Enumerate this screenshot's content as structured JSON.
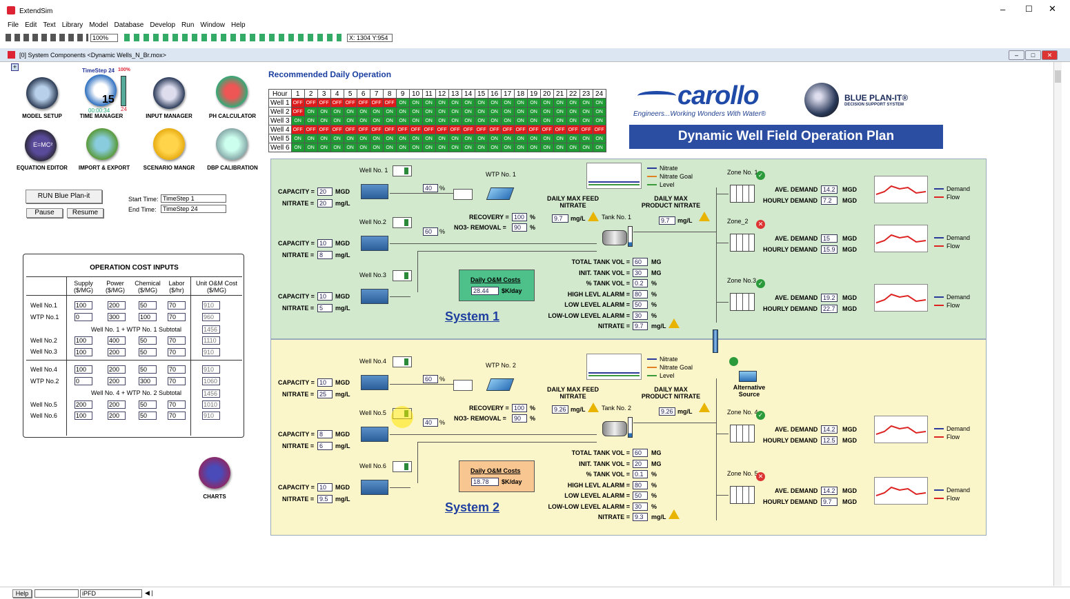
{
  "app": {
    "title": "ExtendSim"
  },
  "menu": [
    "File",
    "Edit",
    "Text",
    "Library",
    "Model",
    "Database",
    "Develop",
    "Run",
    "Window",
    "Help"
  ],
  "toolbar": {
    "zoom": "100%",
    "coords": "X: 1304  Y:954"
  },
  "doc": {
    "title": "[0]  System Components   <Dynamic Wells_N_Br.mox>"
  },
  "header": {
    "timestep": "TimeStep 24",
    "percent": "100%",
    "clock": "00:00:34",
    "day": "15",
    "step": "24"
  },
  "icons": [
    {
      "label": "MODEL SETUP"
    },
    {
      "label": "TIME MANAGER"
    },
    {
      "label": "INPUT MANAGER"
    },
    {
      "label": "PH CALCULATOR"
    },
    {
      "label": "EQUATION EDITOR"
    },
    {
      "label": "IMPORT & EXPORT"
    },
    {
      "label": "SCENARIO MANGR"
    },
    {
      "label": "DBP CALIBRATION"
    }
  ],
  "controls": {
    "run": "RUN Blue Plan-it",
    "pause": "Pause",
    "resume": "Resume",
    "start_label": "Start Time:",
    "start": "TimeStep 1",
    "end_label": "End Time:",
    "end": "TimeStep 24"
  },
  "cost": {
    "title": "OPERATION COST INPUTS",
    "headers": [
      "Supply\n($/MG)",
      "Power\n($/MG)",
      "Chemical\n($/MG)",
      "Labor\n($/hr)",
      "Unit O&M Cost\n($/MG)"
    ],
    "rows": [
      {
        "name": "Well No.1",
        "v": [
          "100",
          "200",
          "50",
          "70",
          "910"
        ]
      },
      {
        "name": "WTP No.1",
        "v": [
          "0",
          "300",
          "100",
          "70",
          "960"
        ]
      },
      {
        "sub": "Well No. 1 + WTP No. 1 Subtotal",
        "total": "1456"
      },
      {
        "name": "Well No.2",
        "v": [
          "100",
          "400",
          "50",
          "70",
          "1110"
        ]
      },
      {
        "name": "Well No.3",
        "v": [
          "100",
          "200",
          "50",
          "70",
          "910"
        ]
      },
      {
        "name": "Well No.4",
        "v": [
          "100",
          "200",
          "50",
          "70",
          "910"
        ]
      },
      {
        "name": "WTP No.2",
        "v": [
          "0",
          "200",
          "300",
          "70",
          "1060"
        ]
      },
      {
        "sub": "Well No. 4 + WTP No. 2 Subtotal",
        "total": "1456"
      },
      {
        "name": "Well No.5",
        "v": [
          "200",
          "200",
          "50",
          "70",
          "1010"
        ]
      },
      {
        "name": "Well No.6",
        "v": [
          "100",
          "200",
          "50",
          "70",
          "910"
        ]
      }
    ]
  },
  "charts_label": "CHARTS",
  "rdo": {
    "title": "Recommended Daily Operation",
    "hour": "Hour",
    "wells": [
      {
        "name": "Well 1",
        "states": [
          "OFF",
          "OFF",
          "OFF",
          "OFF",
          "OFF",
          "OFF",
          "OFF",
          "OFF",
          "ON",
          "ON",
          "ON",
          "ON",
          "ON",
          "ON",
          "ON",
          "ON",
          "ON",
          "ON",
          "ON",
          "ON",
          "ON",
          "ON",
          "ON",
          "ON"
        ]
      },
      {
        "name": "Well 2",
        "states": [
          "OFF",
          "ON",
          "ON",
          "ON",
          "ON",
          "ON",
          "ON",
          "ON",
          "ON",
          "ON",
          "ON",
          "ON",
          "ON",
          "ON",
          "ON",
          "ON",
          "ON",
          "ON",
          "ON",
          "ON",
          "ON",
          "ON",
          "ON",
          "ON"
        ]
      },
      {
        "name": "Well 3",
        "states": [
          "ON",
          "ON",
          "ON",
          "ON",
          "ON",
          "ON",
          "ON",
          "ON",
          "ON",
          "ON",
          "ON",
          "ON",
          "ON",
          "ON",
          "ON",
          "ON",
          "ON",
          "ON",
          "ON",
          "ON",
          "ON",
          "ON",
          "ON",
          "ON"
        ]
      },
      {
        "name": "Well 4",
        "states": [
          "OFF",
          "OFF",
          "OFF",
          "OFF",
          "OFF",
          "OFF",
          "OFF",
          "OFF",
          "OFF",
          "OFF",
          "OFF",
          "OFF",
          "OFF",
          "OFF",
          "OFF",
          "OFF",
          "OFF",
          "OFF",
          "OFF",
          "OFF",
          "OFF",
          "OFF",
          "OFF",
          "OFF"
        ]
      },
      {
        "name": "Well 5",
        "states": [
          "ON",
          "ON",
          "ON",
          "ON",
          "ON",
          "ON",
          "ON",
          "ON",
          "ON",
          "ON",
          "ON",
          "ON",
          "ON",
          "ON",
          "ON",
          "ON",
          "ON",
          "ON",
          "ON",
          "ON",
          "ON",
          "ON",
          "ON",
          "ON"
        ]
      },
      {
        "name": "Well 6",
        "states": [
          "ON",
          "ON",
          "ON",
          "ON",
          "ON",
          "ON",
          "ON",
          "ON",
          "ON",
          "ON",
          "ON",
          "ON",
          "ON",
          "ON",
          "ON",
          "ON",
          "ON",
          "ON",
          "ON",
          "ON",
          "ON",
          "ON",
          "ON",
          "ON"
        ]
      }
    ]
  },
  "brand": {
    "carollo": "carollo",
    "tagline": "Engineers...Working Wonders With Water®",
    "bp": "BLUE PLAN-IT®",
    "bp_sub": "DECISION SUPPORT SYSTEM",
    "banner": "Dynamic Well Field Operation Plan"
  },
  "s1": {
    "title": "System 1",
    "w1": {
      "label": "Well No. 1",
      "cap": "20",
      "nit": "20"
    },
    "w2": {
      "label": "Well No.2",
      "cap": "10",
      "nit": "8"
    },
    "w3": {
      "label": "Well No.3",
      "cap": "10",
      "nit": "5"
    },
    "wtp": "WTP No. 1",
    "p1": "40",
    "p2": "60",
    "rec": "100",
    "no3": "90",
    "feed": "9.7",
    "prod": "9.7",
    "tank": "Tank No. 1",
    "om": "Daily O&M Costs",
    "omv": "28.44",
    "ttv": "60",
    "init": "30",
    "pct": "0.2",
    "hi": "80",
    "lo": "50",
    "lolo": "30",
    "nit": "9.7",
    "z1": {
      "label": "Zone No. 1",
      "d": "14.2",
      "h": "7.2"
    },
    "z2": {
      "label": "Zone_2",
      "d": "15",
      "h": "15.9"
    },
    "z3": {
      "label": "Zone No.3",
      "d": "19.2",
      "h": "22.7"
    }
  },
  "s2": {
    "title": "System 2",
    "w4": {
      "label": "Well No.4",
      "cap": "10",
      "nit": "25"
    },
    "w5": {
      "label": "Well No.5",
      "cap": "8",
      "nit": "6"
    },
    "w6": {
      "label": "Well No.6",
      "cap": "10",
      "nit": "9.5"
    },
    "wtp": "WTP No. 2",
    "p1": "60",
    "p2": "40",
    "rec": "100",
    "no3": "90",
    "feed": "9.26",
    "prod": "9.26",
    "tank": "Tank No. 2",
    "om": "Daily O&M Costs",
    "omv": "18.78",
    "ttv": "60",
    "init": "20",
    "pct": "0.1",
    "hi": "80",
    "lo": "50",
    "lolo": "30",
    "nit": "9.3",
    "z4": {
      "label": "Zone No. 4",
      "d": "14.2",
      "h": "12.5"
    },
    "z5": {
      "label": "Zone No. 5",
      "d": "14.2",
      "h": "9.7"
    },
    "alt": "Alternative Source"
  },
  "labels": {
    "capacity": "CAPACITY =",
    "nitrate": "NITRATE =",
    "mgd": "MGD",
    "mgl": "mg/L",
    "pctsign": "%",
    "recovery": "RECOVERY =",
    "no3": "NO3- REMOVAL =",
    "feed": "DAILY MAX FEED NITRATE",
    "prod": "DAILY MAX PRODUCT NITRATE",
    "kday": "$K/day",
    "ttv": "TOTAL TANK VOL =",
    "init": "INIT. TANK VOL =",
    "pct": "% TANK VOL =",
    "hi": "HIGH LEVL ALARM =",
    "lo": "LOW LEVEL ALARM =",
    "lolo": "LOW-LOW LEVEL  ALARM =",
    "tnit": "NITRATE =",
    "mg": "MG",
    "ave": "AVE. DEMAND",
    "hourly": "HOURLY DEMAND",
    "demand": "Demand",
    "flow": "Flow",
    "nl": "Nitrate",
    "ng": "Nitrate Goal",
    "lv": "Level"
  },
  "status": {
    "help": "Help",
    "lib": "iPFD"
  },
  "colors": {
    "on": "#1f9b34",
    "off": "#e01a1a",
    "sys1": "#d2e9cd",
    "sys2": "#fbf6c9",
    "banner": "#2b4ea2"
  }
}
